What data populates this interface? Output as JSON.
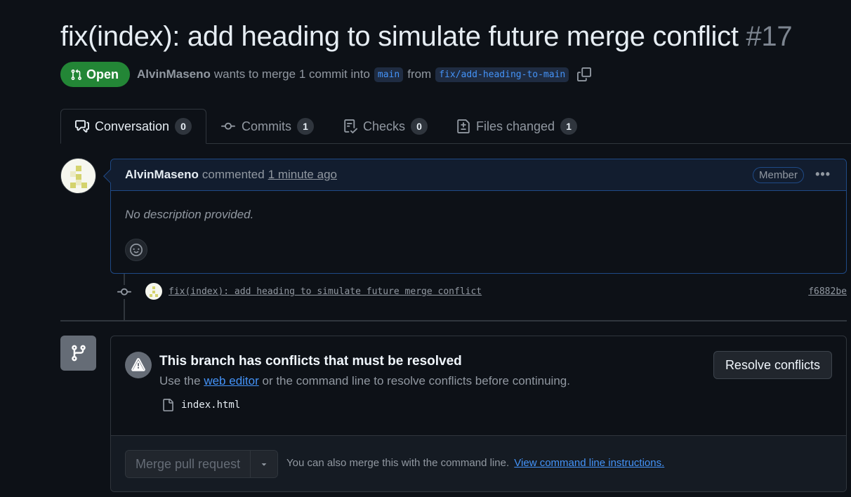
{
  "pr": {
    "title": "fix(index): add heading to simulate future merge conflict",
    "number": "#17",
    "state": "Open",
    "author": "AlvinMaseno",
    "merge_text": "wants to merge 1 commit into",
    "base_branch": "main",
    "from_text": "from",
    "head_branch": "fix/add-heading-to-main"
  },
  "tabs": [
    {
      "label": "Conversation",
      "count": "0",
      "icon": "comment-discussion-icon"
    },
    {
      "label": "Commits",
      "count": "1",
      "icon": "git-commit-icon"
    },
    {
      "label": "Checks",
      "count": "0",
      "icon": "checklist-icon"
    },
    {
      "label": "Files changed",
      "count": "1",
      "icon": "file-diff-icon"
    }
  ],
  "comment": {
    "author": "AlvinMaseno",
    "action": "commented",
    "time": "1 minute ago",
    "badge": "Member",
    "body": "No description provided."
  },
  "commit": {
    "message": "fix(index): add heading to simulate future merge conflict",
    "sha": "f6882be"
  },
  "merge": {
    "conflict_title": "This branch has conflicts that must be resolved",
    "desc_prefix": "Use the",
    "desc_link": "web editor",
    "desc_suffix": "or the command line to resolve conflicts before continuing.",
    "conflict_file": "index.html",
    "resolve_button": "Resolve conflicts",
    "merge_button": "Merge pull request",
    "cli_text": "You can also merge this with the command line.",
    "cli_link": "View command line instructions."
  },
  "colors": {
    "background": "#0d1117",
    "open_green": "#238636",
    "link_blue": "#4493f8",
    "comment_border": "#1f4a86"
  }
}
